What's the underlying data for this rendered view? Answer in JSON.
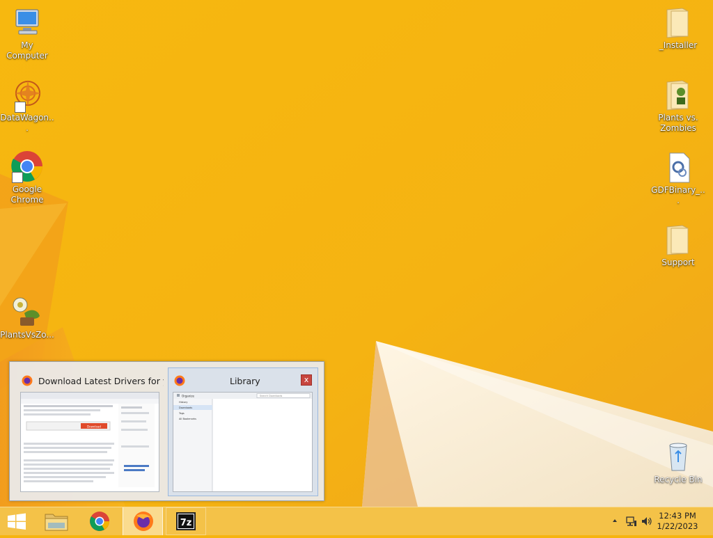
{
  "desktop": {
    "icons_left": [
      {
        "label": "My Computer"
      },
      {
        "label": "DataWagon..."
      },
      {
        "label": "Google Chrome"
      },
      {
        "label": "PlantsVsZo..."
      }
    ],
    "icons_right": [
      {
        "label": "_Installer"
      },
      {
        "label": "Plants vs. Zombies"
      },
      {
        "label": "GDFBinary_..."
      },
      {
        "label": "Support"
      },
      {
        "label": "Recycle Bin"
      }
    ]
  },
  "flyout": {
    "windows": [
      {
        "title": "Download Latest Drivers for you...",
        "icon": "firefox-icon",
        "selected": false
      },
      {
        "title": "Library",
        "icon": "firefox-icon",
        "selected": true,
        "close": "x"
      }
    ],
    "library_preview": {
      "toolbar_organize": "Organize",
      "search_placeholder": "Search Downloads",
      "tree": [
        "History",
        "Downloads",
        "Tags",
        "All Bookmarks"
      ]
    },
    "driver_preview": {
      "download_button": "Download"
    }
  },
  "taskbar": {
    "apps": [
      "start-icon",
      "file-explorer-icon",
      "chrome-icon",
      "firefox-icon",
      "7zip-icon"
    ],
    "seven_zip_label": "7z",
    "clock_time": "12:43 PM",
    "clock_date": "1/22/2023",
    "tray_icons": [
      "tray-chevron-icon",
      "network-icon",
      "volume-icon"
    ]
  },
  "colors": {
    "wallpaper": "#f6b410",
    "taskbar": "#f4c450",
    "accent_red": "#c7463f"
  }
}
